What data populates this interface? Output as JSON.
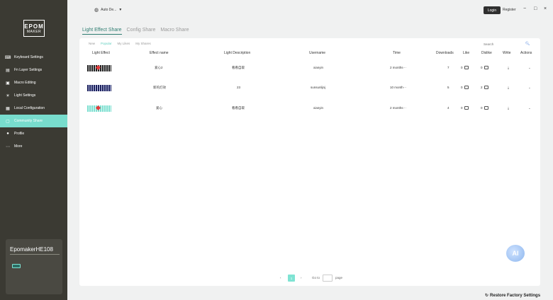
{
  "app": {
    "logo_line1": "EPOM",
    "logo_line2": "MAKER"
  },
  "sidebar": {
    "items": [
      {
        "label": "Keyboard Settings",
        "icon": "keyboard-icon"
      },
      {
        "label": "Fn Layer Settings",
        "icon": "layers-icon"
      },
      {
        "label": "Macro Editing",
        "icon": "macro-icon"
      },
      {
        "label": "Light Settings",
        "icon": "light-icon"
      },
      {
        "label": "Local Configuration",
        "icon": "folder-icon"
      },
      {
        "label": "Community Share",
        "icon": "share-icon",
        "active": true
      },
      {
        "label": "Profile",
        "icon": "user-icon"
      },
      {
        "label": "More",
        "icon": "more-icon"
      }
    ],
    "device_name": "EpomakerHE108"
  },
  "topbar": {
    "language": "Auto De...",
    "login_label": "Login",
    "register_label": "Register",
    "minimize": "−",
    "maximize": "□",
    "close": "×"
  },
  "tabs": [
    "Light Effect Share",
    "Config Share",
    "Macro Share"
  ],
  "subtabs": [
    "New",
    "Popular",
    "My Likes",
    "My Shares"
  ],
  "search": {
    "placeholder": "Search"
  },
  "columns": [
    "Light Effect",
    "Effect name",
    "Light Description",
    "Username",
    "Time",
    "Downloads",
    "Like",
    "Dislike",
    "Write",
    "Actions"
  ],
  "rows": [
    {
      "effect_name": "爱心2",
      "description": "看看自取",
      "username": "xianyin",
      "time": "2 months···",
      "downloads": "7",
      "like": "0",
      "dislike": "0"
    },
    {
      "effect_name": "新的灯效",
      "description": "23",
      "username": "sunsunlijnj",
      "time": "10 month···",
      "downloads": "5",
      "like": "0",
      "dislike": "2"
    },
    {
      "effect_name": "爱心",
      "description": "看看自取",
      "username": "xianyin",
      "time": "2 months···",
      "downloads": "4",
      "like": "0",
      "dislike": "0"
    }
  ],
  "pagination": {
    "prev": "‹",
    "current": "1",
    "next": "›",
    "goto_label": "Go to",
    "page_label": "page"
  },
  "ai_label": "AI",
  "footer": {
    "restore_label": "Restore Factory Settings"
  },
  "colors": {
    "accent": "#78dccd",
    "sidebar_bg": "#3b3a33"
  }
}
